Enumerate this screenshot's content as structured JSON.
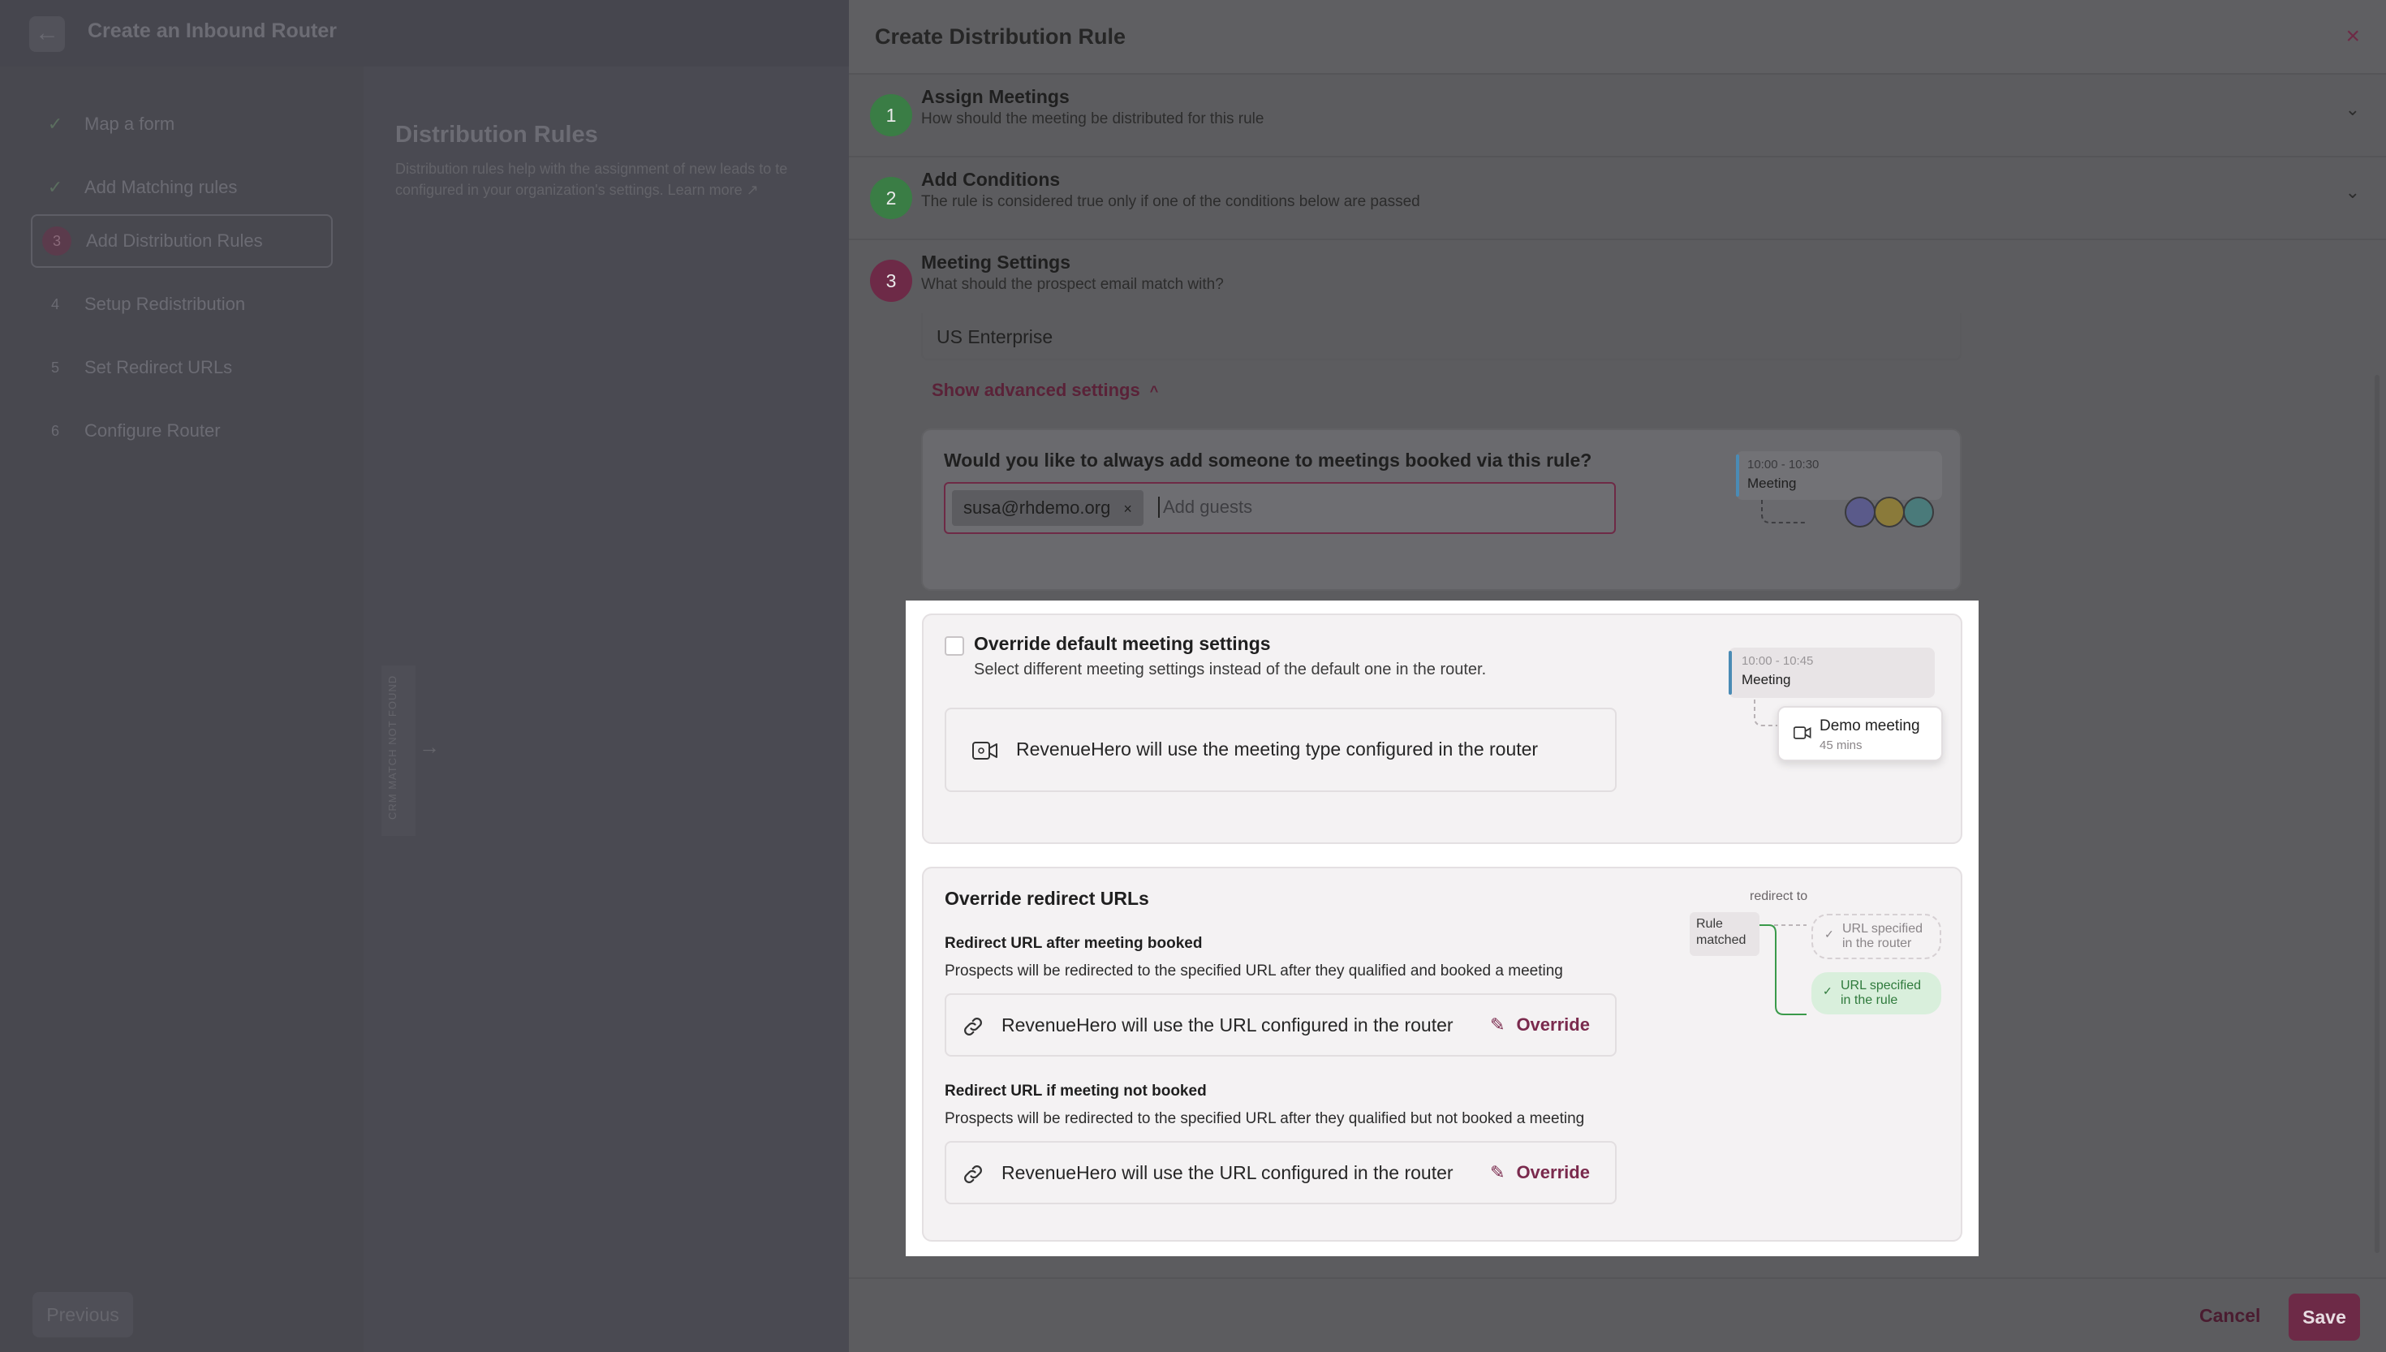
{
  "background": {
    "header_title": "Create an Inbound Router",
    "back_icon": "←",
    "steps": [
      {
        "marker": "✓",
        "label": "Map a form"
      },
      {
        "marker": "✓",
        "label": "Add Matching rules"
      },
      {
        "marker": "3",
        "label": "Add Distribution Rules"
      },
      {
        "marker": "4",
        "label": "Setup Redistribution"
      },
      {
        "marker": "5",
        "label": "Set Redirect URLs"
      },
      {
        "marker": "6",
        "label": "Configure Router"
      }
    ],
    "main_title": "Distribution Rules",
    "main_desc": "Distribution rules help with the assignment of new leads to te configured in your organization's settings. Learn more ↗",
    "vertical_label": "CRM MATCH NOT FOUND",
    "arrow": "→",
    "previous_label": "Previous"
  },
  "modal": {
    "title": "Create Distribution Rule",
    "close_icon": "×",
    "sections": [
      {
        "num": "1",
        "title": "Assign Meetings",
        "subtitle": "How should the meeting be distributed for this rule"
      },
      {
        "num": "2",
        "title": "Add Conditions",
        "subtitle": "The rule is considered true only if one of the conditions below are passed"
      },
      {
        "num": "3",
        "title": "Meeting Settings",
        "subtitle": "What should the prospect email match with?"
      }
    ],
    "chevron": "⌄",
    "team_value": "US Enterprise",
    "advanced_label": "Show advanced settings",
    "advanced_caret": "^",
    "guests": {
      "question": "Would you like to always add someone to meetings booked via this rule?",
      "chip": "susa@rhdemo.org",
      "chip_remove": "×",
      "placeholder": "Add guests",
      "ill_time": "10:00 - 10:30",
      "ill_label": "Meeting"
    },
    "override_meeting": {
      "title": "Override default meeting settings",
      "subtitle": "Select different meeting settings instead of the default one in the router.",
      "info": "RevenueHero will use the meeting type configured in the router",
      "ill_time": "10:00 - 10:45",
      "ill_label": "Meeting",
      "ill_pop_title": "Demo meeting",
      "ill_pop_sub": "45 mins"
    },
    "override_urls": {
      "title": "Override redirect URLs",
      "booked_title": "Redirect URL after meeting booked",
      "booked_desc": "Prospects will be redirected to the specified URL after they qualified and booked a meeting",
      "booked_info": "RevenueHero will use the URL configured in the router",
      "override_label": "Override",
      "notbooked_title": "Redirect URL if meeting not booked",
      "notbooked_desc": "Prospects will be redirected to the specified URL after they qualified but not booked a meeting",
      "notbooked_info": "RevenueHero will use the URL configured in the router",
      "ill_redirect": "redirect to",
      "ill_rule_line1": "Rule",
      "ill_rule_line2": "matched",
      "ill_router_line1": "URL specified",
      "ill_router_line2": "in the router",
      "ill_rule_url_line1": "URL specified",
      "ill_rule_url_line2": "in the rule"
    },
    "cancel_label": "Cancel",
    "save_label": "Save"
  },
  "colors": {
    "accent": "#7a2a4d",
    "success": "#3a7d45",
    "link_green_bg": "#d9efdc"
  }
}
